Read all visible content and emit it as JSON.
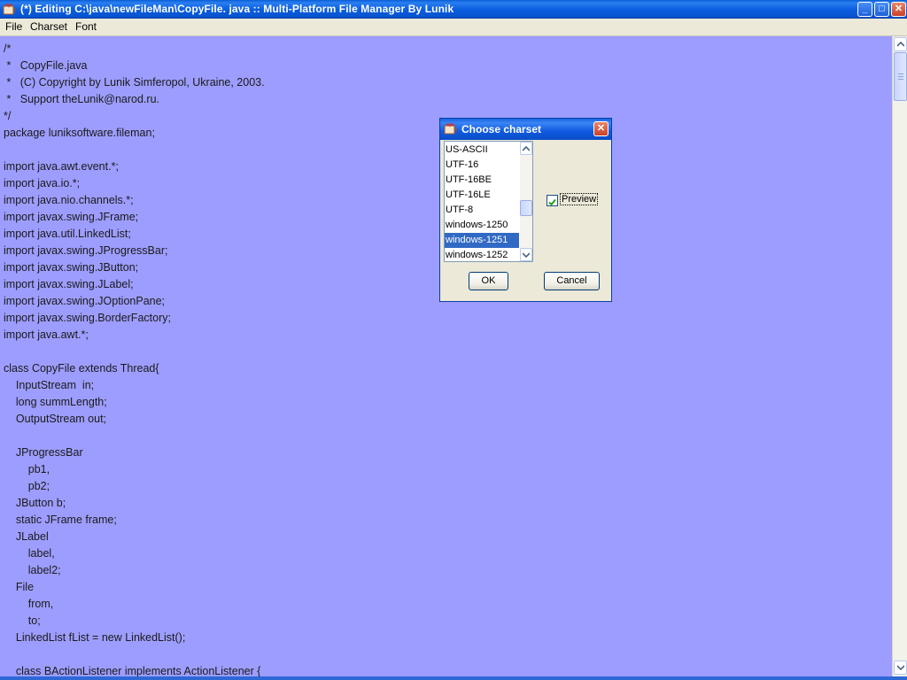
{
  "window": {
    "title": "(*) Editing C:\\java\\newFileMan\\CopyFile. java :: Multi-Platform File Manager By Lunik",
    "controls": {
      "minimize": "_",
      "maximize": "□",
      "close": "✕"
    }
  },
  "menu": {
    "file": "File",
    "charset": "Charset",
    "font": "Font"
  },
  "code_lines": [
    "/*",
    " *   CopyFile.java",
    " *   (C) Copyright by Lunik Simferopol, Ukraine, 2003.",
    " *   Support theLunik@narod.ru.",
    "*/",
    "package luniksoftware.fileman;",
    "",
    "import java.awt.event.*;",
    "import java.io.*;",
    "import java.nio.channels.*;",
    "import javax.swing.JFrame;",
    "import java.util.LinkedList;",
    "import javax.swing.JProgressBar;",
    "import javax.swing.JButton;",
    "import javax.swing.JLabel;",
    "import javax.swing.JOptionPane;",
    "import javax.swing.BorderFactory;",
    "import java.awt.*;",
    "",
    "class CopyFile extends Thread{",
    "    InputStream  in;",
    "    long summLength;",
    "    OutputStream out;",
    "",
    "    JProgressBar",
    "        pb1,",
    "        pb2;",
    "    JButton b;",
    "    static JFrame frame;",
    "    JLabel",
    "        label,",
    "        label2;",
    "    File",
    "        from,",
    "        to;",
    "    LinkedList fList = new LinkedList();",
    "",
    "    class BActionListener implements ActionListener {"
  ],
  "dialog": {
    "title": "Choose charset",
    "charsets": [
      "US-ASCII",
      "UTF-16",
      "UTF-16BE",
      "UTF-16LE",
      "UTF-8",
      "windows-1250",
      "windows-1251",
      "windows-1252"
    ],
    "selected": "windows-1251",
    "preview_label": "Preview",
    "preview_checked": true,
    "ok_label": "OK",
    "cancel_label": "Cancel"
  },
  "colors": {
    "editor_bg": "#9d9dff",
    "titlebar": "#0b5ee0",
    "selection": "#316ac5"
  }
}
